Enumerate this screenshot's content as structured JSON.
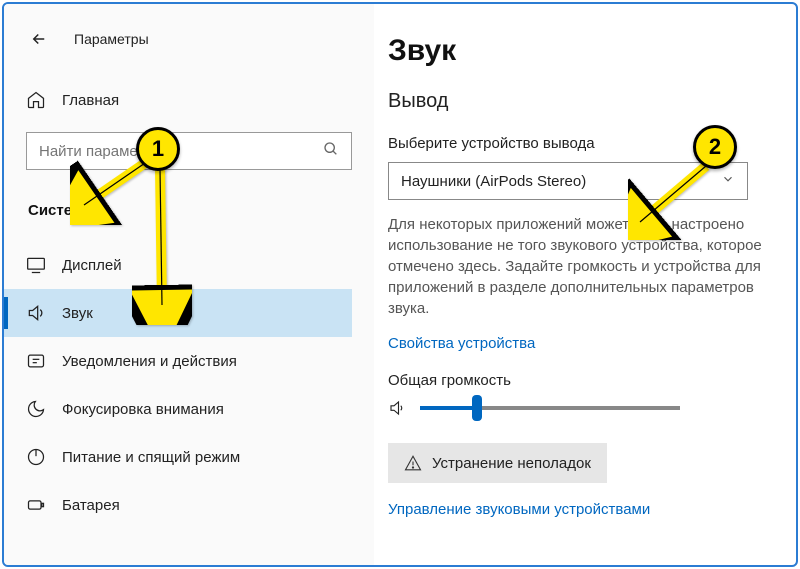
{
  "window": {
    "title": "Параметры"
  },
  "sidebar": {
    "home": "Главная",
    "search_placeholder": "Найти параметр",
    "section": "Система",
    "items": [
      {
        "label": "Дисплей"
      },
      {
        "label": "Звук"
      },
      {
        "label": "Уведомления и действия"
      },
      {
        "label": "Фокусировка внимания"
      },
      {
        "label": "Питание и спящий режим"
      },
      {
        "label": "Батарея"
      }
    ]
  },
  "content": {
    "title": "Звук",
    "output_header": "Вывод",
    "output_label": "Выберите устройство вывода",
    "output_device": "Наушники (AirPods Stereo)",
    "desc": "Для некоторых приложений может быть настроено использование не того звукового устройства, которое отмечено здесь. Задайте громкость и устройства для приложений в разделе дополнительных параметров звука.",
    "device_props": "Свойства устройства",
    "volume_label": "Общая громкость",
    "troubleshoot": "Устранение неполадок",
    "manage_link": "Управление звуковыми устройствами"
  },
  "markers": {
    "m1": "1",
    "m2": "2"
  }
}
